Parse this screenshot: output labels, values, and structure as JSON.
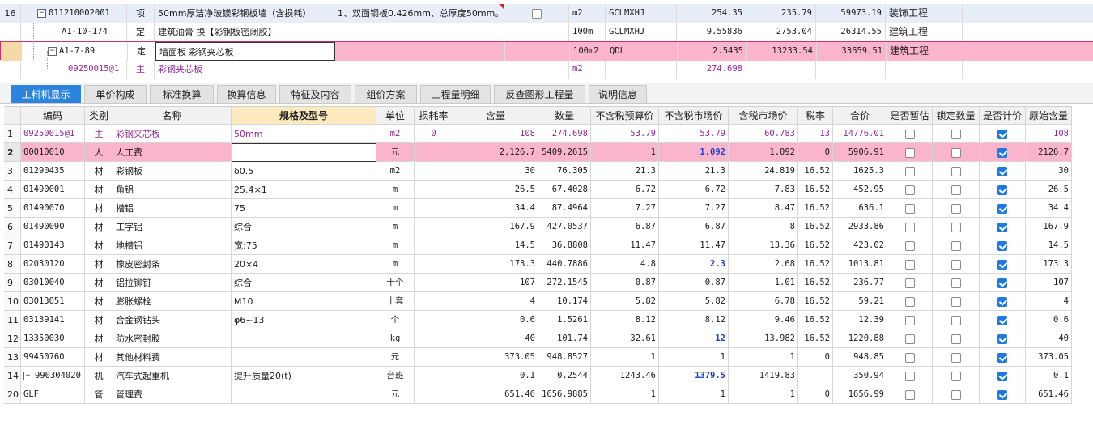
{
  "top_rows": [
    {
      "index": "16",
      "code": "011210002001",
      "type": "项",
      "name": "50mm厚洁净玻镁彩钢板墙（含损耗）",
      "feature": "1、双面钢板0.426mm、总厚度50mm。⋯",
      "unit": "m2",
      "qty_expr": "GCLMXHJ",
      "quantity": "254.35",
      "unit_price": "235.79",
      "total": "59973.19",
      "major": "装饰工程"
    },
    {
      "code": "A1-10-174",
      "type": "定",
      "name": "建筑油膏 换【彩钢板密闭胶】",
      "unit": "100m",
      "qty_expr": "GCLMXHJ",
      "quantity": "9.55836",
      "unit_price": "2753.04",
      "total": "26314.55",
      "major": "建筑工程"
    },
    {
      "code": "A1-7-89",
      "type": "定",
      "name": "墙面板 彩钢夹芯板",
      "unit": "100m2",
      "qty_expr": "QDL",
      "quantity": "2.5435",
      "unit_price": "13233.54",
      "total": "33659.51",
      "major": "建筑工程"
    },
    {
      "code": "09250015@1",
      "type": "主",
      "name": "彩钢夹芯板",
      "unit": "m2",
      "quantity": "274.698"
    }
  ],
  "tabs": [
    "工料机显示",
    "单价构成",
    "标准换算",
    "换算信息",
    "特征及内容",
    "组价方案",
    "工程量明细",
    "反查图形工程量",
    "说明信息"
  ],
  "columns": [
    "编码",
    "类别",
    "名称",
    "规格及型号",
    "单位",
    "损耗率",
    "含量",
    "数量",
    "不含税预算价",
    "不含税市场价",
    "含税市场价",
    "税率",
    "合价",
    "是否暂估",
    "锁定数量",
    "是否计价",
    "原始含量"
  ],
  "rows": [
    {
      "idx": "1",
      "code": "09250015@1",
      "type": "主",
      "name": "彩钢夹芯板",
      "spec": "50mm",
      "unit": "m2",
      "loss": "0",
      "content": "108",
      "qty": "274.698",
      "budget": "53.79",
      "market": "53.79",
      "tax_market": "60.783",
      "rate": "13",
      "total": "14776.01",
      "temp": false,
      "lock": false,
      "price": true,
      "orig": "108"
    },
    {
      "idx": "2",
      "code": "00010010",
      "type": "人",
      "name": "人工费",
      "spec": "",
      "unit": "元",
      "loss": "",
      "content": "2,126.7",
      "qty": "5409.2615",
      "budget": "1",
      "market": "1.092",
      "tax_market": "1.092",
      "rate": "0",
      "total": "5906.91",
      "temp": false,
      "lock": false,
      "price": true,
      "orig": "2126.7"
    },
    {
      "idx": "3",
      "code": "01290435",
      "type": "材",
      "name": "彩钢板",
      "spec": "δ0.5",
      "unit": "m2",
      "loss": "",
      "content": "30",
      "qty": "76.305",
      "budget": "21.3",
      "market": "21.3",
      "tax_market": "24.819",
      "rate": "16.52",
      "total": "1625.3",
      "temp": false,
      "lock": false,
      "price": true,
      "orig": "30"
    },
    {
      "idx": "4",
      "code": "01490001",
      "type": "材",
      "name": "角铝",
      "spec": "25.4×1",
      "unit": "m",
      "loss": "",
      "content": "26.5",
      "qty": "67.4028",
      "budget": "6.72",
      "market": "6.72",
      "tax_market": "7.83",
      "rate": "16.52",
      "total": "452.95",
      "temp": false,
      "lock": false,
      "price": true,
      "orig": "26.5"
    },
    {
      "idx": "5",
      "code": "01490070",
      "type": "材",
      "name": "槽铝",
      "spec": "75",
      "unit": "m",
      "loss": "",
      "content": "34.4",
      "qty": "87.4964",
      "budget": "7.27",
      "market": "7.27",
      "tax_market": "8.47",
      "rate": "16.52",
      "total": "636.1",
      "temp": false,
      "lock": false,
      "price": true,
      "orig": "34.4"
    },
    {
      "idx": "6",
      "code": "01490090",
      "type": "材",
      "name": "工字铝",
      "spec": "综合",
      "unit": "m",
      "loss": "",
      "content": "167.9",
      "qty": "427.0537",
      "budget": "6.87",
      "market": "6.87",
      "tax_market": "8",
      "rate": "16.52",
      "total": "2933.86",
      "temp": false,
      "lock": false,
      "price": true,
      "orig": "167.9"
    },
    {
      "idx": "7",
      "code": "01490143",
      "type": "材",
      "name": "地槽铝",
      "spec": "宽:75",
      "unit": "m",
      "loss": "",
      "content": "14.5",
      "qty": "36.8808",
      "budget": "11.47",
      "market": "11.47",
      "tax_market": "13.36",
      "rate": "16.52",
      "total": "423.02",
      "temp": false,
      "lock": false,
      "price": true,
      "orig": "14.5"
    },
    {
      "idx": "8",
      "code": "02030120",
      "type": "材",
      "name": "橡皮密封条",
      "spec": "20×4",
      "unit": "m",
      "loss": "",
      "content": "173.3",
      "qty": "440.7886",
      "budget": "4.8",
      "market": "2.3",
      "tax_market": "2.68",
      "rate": "16.52",
      "total": "1013.81",
      "temp": false,
      "lock": false,
      "price": true,
      "orig": "173.3"
    },
    {
      "idx": "9",
      "code": "03010040",
      "type": "材",
      "name": "铝拉铆钉",
      "spec": "综合",
      "unit": "十个",
      "loss": "",
      "content": "107",
      "qty": "272.1545",
      "budget": "0.87",
      "market": "0.87",
      "tax_market": "1.01",
      "rate": "16.52",
      "total": "236.77",
      "temp": false,
      "lock": false,
      "price": true,
      "orig": "107"
    },
    {
      "idx": "10",
      "code": "03013051",
      "type": "材",
      "name": "膨胀螺栓",
      "spec": "M10",
      "unit": "十套",
      "loss": "",
      "content": "4",
      "qty": "10.174",
      "budget": "5.82",
      "market": "5.82",
      "tax_market": "6.78",
      "rate": "16.52",
      "total": "59.21",
      "temp": false,
      "lock": false,
      "price": true,
      "orig": "4"
    },
    {
      "idx": "11",
      "code": "03139141",
      "type": "材",
      "name": "合金钢钻头",
      "spec": "φ6~13",
      "unit": "个",
      "loss": "",
      "content": "0.6",
      "qty": "1.5261",
      "budget": "8.12",
      "market": "8.12",
      "tax_market": "9.46",
      "rate": "16.52",
      "total": "12.39",
      "temp": false,
      "lock": false,
      "price": true,
      "orig": "0.6"
    },
    {
      "idx": "12",
      "code": "13350030",
      "type": "材",
      "name": "防水密封胶",
      "spec": "",
      "unit": "kg",
      "loss": "",
      "content": "40",
      "qty": "101.74",
      "budget": "32.61",
      "market": "12",
      "tax_market": "13.982",
      "rate": "16.52",
      "total": "1220.88",
      "temp": false,
      "lock": false,
      "price": true,
      "orig": "40"
    },
    {
      "idx": "13",
      "code": "99450760",
      "type": "材",
      "name": "其他材料费",
      "spec": "",
      "unit": "元",
      "loss": "",
      "content": "373.05",
      "qty": "948.8527",
      "budget": "1",
      "market": "1",
      "tax_market": "1",
      "rate": "0",
      "total": "948.85",
      "temp": false,
      "lock": false,
      "price": true,
      "orig": "373.05"
    },
    {
      "idx": "14",
      "code": "990304020",
      "type": "机",
      "name": "汽车式起重机",
      "spec": "提升质量20(t)",
      "unit": "台班",
      "loss": "",
      "content": "0.1",
      "qty": "0.2544",
      "budget": "1243.46",
      "market": "1379.5",
      "tax_market": "1419.83",
      "rate": "",
      "total": "350.94",
      "temp": false,
      "lock": false,
      "price": true,
      "orig": "0.1"
    },
    {
      "idx": "20",
      "code": "GLF",
      "type": "管",
      "name": "管理费",
      "spec": "",
      "unit": "元",
      "loss": "",
      "content": "651.46",
      "qty": "1656.9885",
      "budget": "1",
      "market": "1",
      "tax_market": "1",
      "rate": "0",
      "total": "1656.99",
      "temp": false,
      "lock": false,
      "price": true,
      "orig": "651.46"
    }
  ],
  "colors": {
    "accent": "#2c84dd",
    "pink_row": "#fab5cc",
    "purple_text": "#8b2b9b",
    "highlight_blue": "#1c3fd0",
    "spec_header": "#fdebbf"
  }
}
